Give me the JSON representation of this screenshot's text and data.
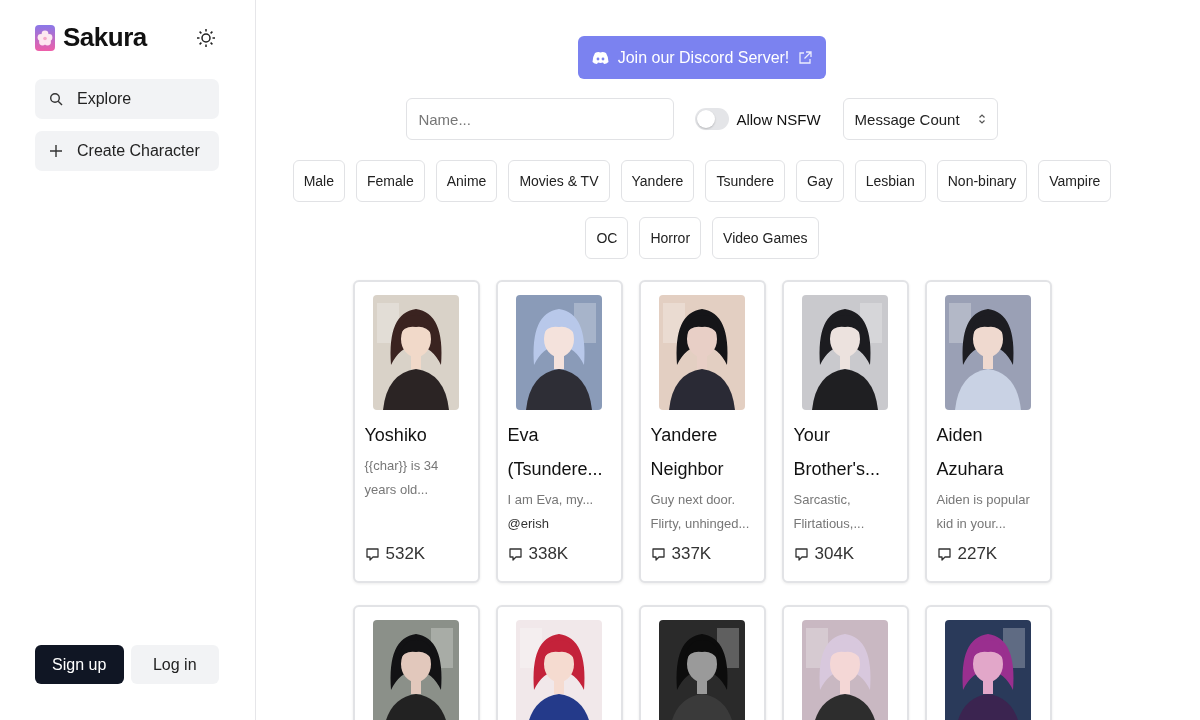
{
  "sidebar": {
    "brand": "Sakura",
    "nav": [
      {
        "label": "Explore"
      },
      {
        "label": "Create Character"
      }
    ],
    "sign_up": "Sign up",
    "log_in": "Log in"
  },
  "discord_button": "Join our Discord Server!",
  "filters": {
    "search": {
      "placeholder": "Name..."
    },
    "nsfw": {
      "label": "Allow NSFW",
      "on": false
    },
    "sort": {
      "value": "Message Count"
    }
  },
  "tags": [
    {
      "label": "Male",
      "selected": false
    },
    {
      "label": "Female",
      "selected": false
    },
    {
      "label": "Anime",
      "selected": false
    },
    {
      "label": "Movies & TV",
      "selected": false
    },
    {
      "label": "Yandere",
      "selected": false
    },
    {
      "label": "Tsundere",
      "selected": false
    },
    {
      "label": "Gay",
      "selected": false
    },
    {
      "label": "Lesbian",
      "selected": false
    },
    {
      "label": "Non-binary",
      "selected": false
    },
    {
      "label": "Vampire",
      "selected": false
    },
    {
      "label": "OC",
      "selected": false
    },
    {
      "label": "Horror",
      "selected": false
    },
    {
      "label": "Video Games",
      "selected": false
    }
  ],
  "cards": [
    {
      "kind": "character",
      "name": "Yoshiko",
      "description": "{{char}} is 34 years old...",
      "messages": "532K"
    },
    {
      "kind": "character",
      "name": "Eva (Tsundere...",
      "description": "I am Eva, my...",
      "author": "@erish",
      "messages": "338K"
    },
    {
      "kind": "character",
      "name": "Yandere Neighbor",
      "description": "Guy next door. Flirty, unhinged...",
      "messages": "337K"
    },
    {
      "kind": "character",
      "name": "Your Brother's...",
      "description": "Sarcastic, Flirtatious,...",
      "messages": "304K"
    },
    {
      "kind": "character",
      "name": "Aiden Azuhara",
      "description": "Aiden is popular kid in your...",
      "messages": "227K"
    },
    {
      "kind": "picture"
    },
    {
      "kind": "picture"
    },
    {
      "kind": "picture"
    },
    {
      "kind": "picture"
    },
    {
      "kind": "picture"
    }
  ]
}
